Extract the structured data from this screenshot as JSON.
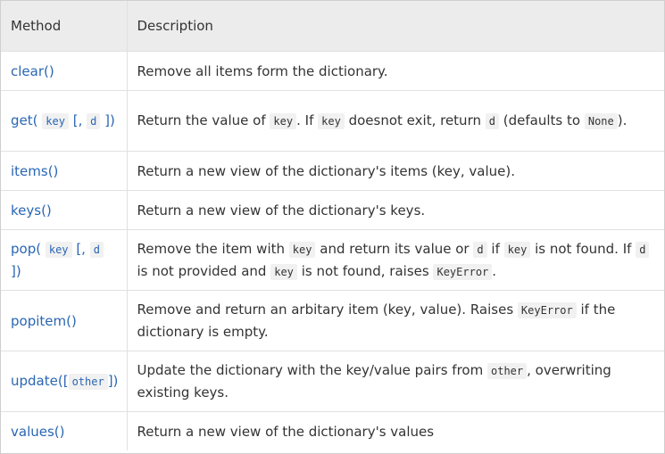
{
  "table": {
    "headers": {
      "method": "Method",
      "description": "Description"
    },
    "rows": [
      {
        "method": {
          "name": "clear()"
        },
        "description": {
          "t1": "Remove all items form the dictionary."
        }
      },
      {
        "method": {
          "name": "get(",
          "arg1": "key",
          "mid": "[,",
          "arg2": "d",
          "end": "])"
        },
        "description": {
          "t1": "Return the value of",
          "c1": "key",
          "t2": ". If",
          "c2": "key",
          "t3": "doesnot exit, return",
          "c3": "d",
          "t4": "(defaults to",
          "c4": "None",
          "t5": ")."
        }
      },
      {
        "method": {
          "name": "items()"
        },
        "description": {
          "t1": "Return a new view of the dictionary's items (key, value)."
        }
      },
      {
        "method": {
          "name": "keys()"
        },
        "description": {
          "t1": "Return a new view of the dictionary's keys."
        }
      },
      {
        "method": {
          "name": "pop(",
          "arg1": "key",
          "mid": "[,",
          "arg2": "d",
          "end": "])"
        },
        "description": {
          "t1": "Remove the item with",
          "c1": "key",
          "t2": "and return its value or",
          "c2": "d",
          "t3": "if",
          "c3": "key",
          "t4": "is not found. If",
          "c4": "d",
          "t5": "is not provided and",
          "c5": "key",
          "t6": "is not found, raises",
          "c6": "KeyError",
          "t7": "."
        }
      },
      {
        "method": {
          "name": "popitem()"
        },
        "description": {
          "t1": "Remove and return an arbitary item (key, value). Raises",
          "c1": "KeyError",
          "t2": "if the dictionary is empty."
        }
      },
      {
        "method": {
          "name": "update([",
          "arg1": "other",
          "end": "])"
        },
        "description": {
          "t1": "Update the dictionary with the key/value pairs from",
          "c1": "other",
          "t2": ", overwriting existing keys."
        }
      },
      {
        "method": {
          "name": "values()"
        },
        "description": {
          "t1": "Return a new view of the dictionary's values"
        }
      }
    ]
  }
}
